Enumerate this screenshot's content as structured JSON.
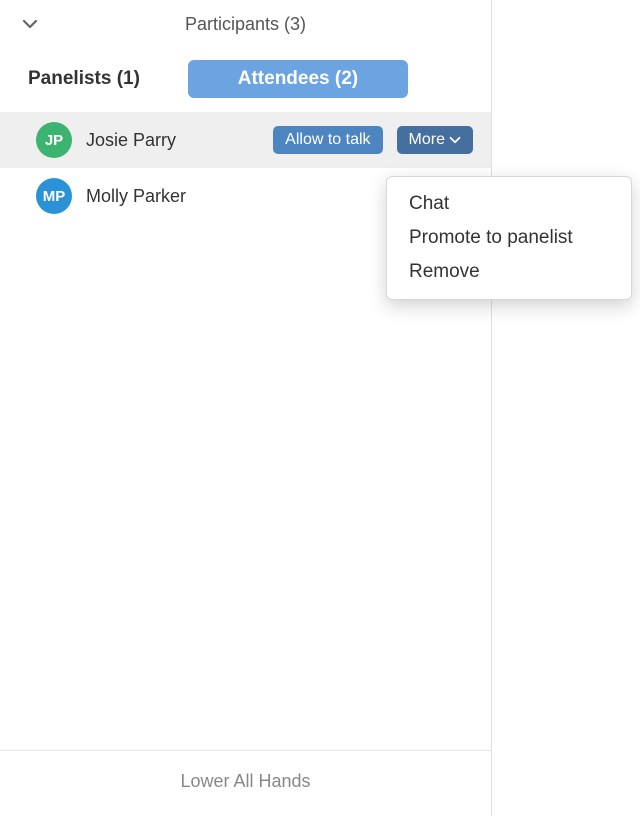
{
  "header": {
    "title": "Participants (3)"
  },
  "tabs": {
    "panelists_label": "Panelists (1)",
    "attendees_label": "Attendees (2)"
  },
  "attendees": [
    {
      "initials": "JP",
      "name": "Josie Parry",
      "avatar_color": "#3cb371",
      "selected": true,
      "allow_label": "Allow to talk",
      "more_label": "More"
    },
    {
      "initials": "MP",
      "name": "Molly Parker",
      "avatar_color": "#2a92d6",
      "selected": false
    }
  ],
  "more_menu": {
    "items": [
      "Chat",
      "Promote to panelist",
      "Remove"
    ]
  },
  "footer": {
    "lower_hands_label": "Lower All Hands"
  }
}
